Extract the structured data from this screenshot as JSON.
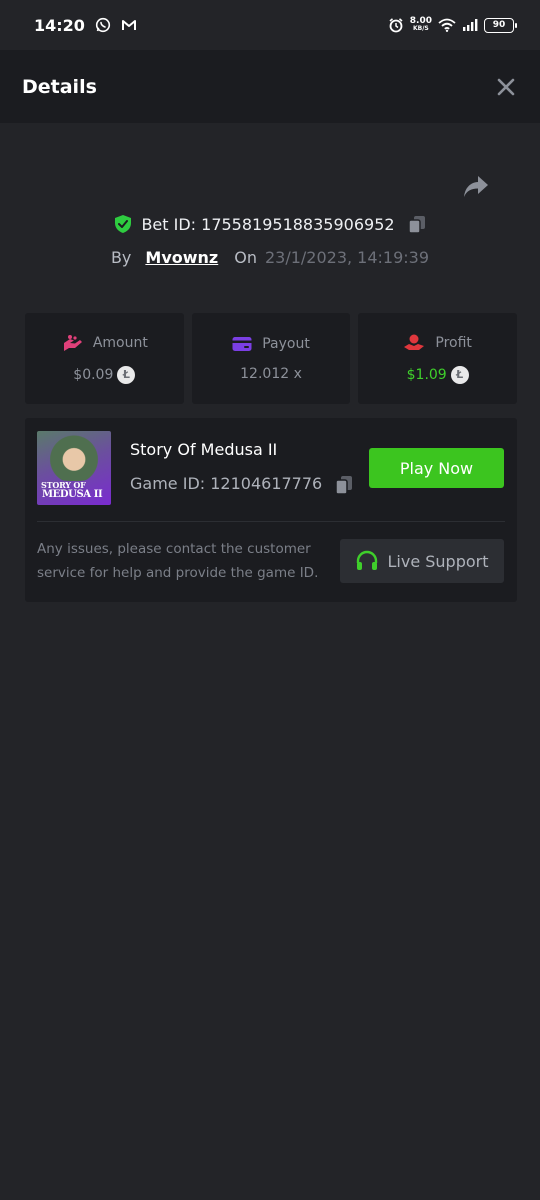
{
  "status_bar": {
    "time": "14:20",
    "speed_value": "8.00",
    "speed_unit": "KB/S",
    "battery": "90",
    "icons": [
      "whatsapp-icon",
      "gmail-icon",
      "alarm-icon",
      "wifi-icon",
      "signal-icon",
      "battery-icon"
    ]
  },
  "header": {
    "title": "Details",
    "close_icon": "close-icon"
  },
  "bet": {
    "id_label": "Bet ID: 1755819518835906952",
    "by_label": "By",
    "username": "Mvownz",
    "on_label": "On",
    "datetime": "23/1/2023, 14:19:39"
  },
  "stats": {
    "amount": {
      "label": "Amount",
      "value": "$0.09",
      "coin": "Ł"
    },
    "payout": {
      "label": "Payout",
      "value": "12.012 x"
    },
    "profit": {
      "label": "Profit",
      "value": "$1.09",
      "coin": "Ł"
    }
  },
  "game": {
    "title": "Story Of Medusa II",
    "id_label": "Game ID: 12104617776",
    "thumb_line1": "STORY OF",
    "thumb_line2": "MEDUSA II",
    "play_label": "Play Now",
    "support_text": "Any issues, please contact the customer service for help and provide the game ID.",
    "support_label": "Live Support"
  },
  "colors": {
    "background": "#232428",
    "card": "#1b1c20",
    "accent_green": "#3cc51f",
    "profit_green": "#3fcf2b",
    "amount_pink": "#e0407a",
    "payout_purple": "#7b3fe4",
    "profit_red": "#e0373d"
  }
}
